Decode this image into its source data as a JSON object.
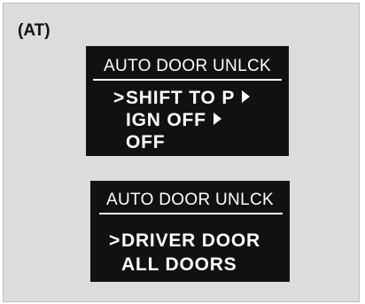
{
  "variant_label": "(AT)",
  "screens": [
    {
      "title": "AUTO DOOR UNLCK",
      "items": [
        {
          "cursor": ">",
          "label": "SHIFT TO P",
          "submenu_icon": "triangle-right-icon"
        },
        {
          "cursor": "",
          "label": "IGN OFF",
          "submenu_icon": "triangle-right-icon"
        },
        {
          "cursor": "",
          "label": "OFF",
          "submenu_icon": ""
        }
      ]
    },
    {
      "title": "AUTO DOOR UNLCK",
      "items": [
        {
          "cursor": ">",
          "label": "DRIVER DOOR",
          "submenu_icon": ""
        },
        {
          "cursor": "",
          "label": "ALL DOORS",
          "submenu_icon": ""
        }
      ]
    }
  ]
}
